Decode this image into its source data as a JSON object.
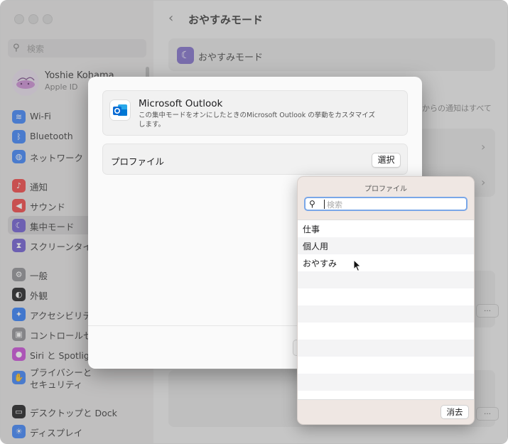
{
  "sidebar": {
    "search_placeholder": "検索",
    "profile": {
      "name": "Yoshie Kohama",
      "sub": "Apple ID"
    },
    "items": [
      {
        "label": "Wi-Fi",
        "icon": "wifi-icon",
        "color": "#3b82f6"
      },
      {
        "label": "Bluetooth",
        "icon": "bluetooth-icon",
        "color": "#3b82f6"
      },
      {
        "label": "ネットワーク",
        "icon": "globe-icon",
        "color": "#3b82f6"
      },
      {
        "label": "通知",
        "icon": "bell-icon",
        "color": "#ef4444"
      },
      {
        "label": "サウンド",
        "icon": "speaker-icon",
        "color": "#ef4444"
      },
      {
        "label": "集中モード",
        "icon": "moon-icon",
        "color": "#6d5bd0"
      },
      {
        "label": "スクリーンタイム",
        "icon": "hourglass-icon",
        "color": "#6d5bd0"
      },
      {
        "label": "一般",
        "icon": "gear-icon",
        "color": "#8e8e93"
      },
      {
        "label": "外観",
        "icon": "appearance-icon",
        "color": "#1d1d1f"
      },
      {
        "label": "アクセシビリティ",
        "icon": "accessibility-icon",
        "color": "#2f7bf6"
      },
      {
        "label": "コントロールセンター",
        "icon": "control-center-icon",
        "color": "#8e8e93"
      },
      {
        "label": "Siri と Spotlight",
        "icon": "siri-icon",
        "color": "#c84bd6"
      },
      {
        "label": "プライバシーと\nセキュリティ",
        "icon": "hand-icon",
        "color": "#3b82f6"
      },
      {
        "label": "デスクトップと Dock",
        "icon": "dock-icon",
        "color": "#1d1d1f"
      },
      {
        "label": "ディスプレイ",
        "icon": "sun-icon",
        "color": "#3b82f6"
      }
    ]
  },
  "main": {
    "title": "おやすみモード",
    "focus_label": "おやすみモード",
    "notice_trailing": "からの通知はすべて"
  },
  "dialog": {
    "app_name": "Microsoft Outlook",
    "app_description": "この集中モードをオンにしたときのMicrosoft Outlook の挙動をカスタマイズします。",
    "profile_label": "プロファイル",
    "select_label": "選択"
  },
  "popover": {
    "title": "プロファイル",
    "search_placeholder": "検索",
    "options": [
      "仕事",
      "個人用",
      "おやすみ"
    ],
    "clear_label": "消去"
  },
  "colors": {
    "focus_accent": "#7f6ec7",
    "search_ring": "#7aa7e8",
    "outlook_blue": "#0a6cd4"
  }
}
